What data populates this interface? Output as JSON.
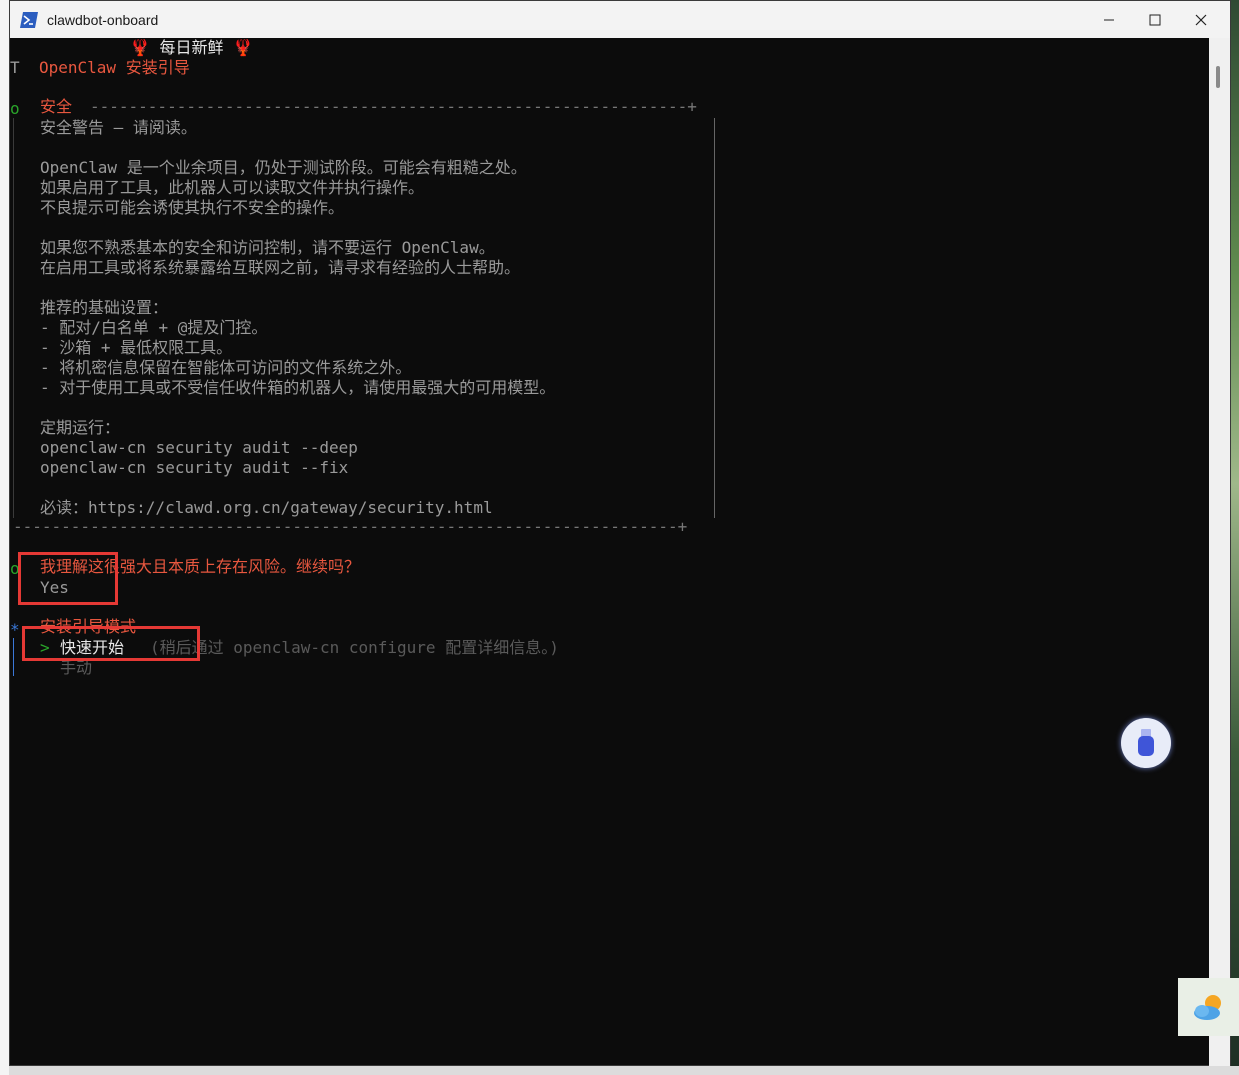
{
  "window": {
    "title": "clawdbot-onboard"
  },
  "terminal": {
    "banner": "🦞 每日新鲜 🦞",
    "heading": "OpenClaw 安装引导",
    "security_title": "安全",
    "warning_lines": [
      "安全警告 — 请阅读。",
      "OpenClaw 是一个业余项目，仍处于测试阶段。可能会有粗糙之处。",
      "如果启用了工具，此机器人可以读取文件并执行操作。",
      "不良提示可能会诱使其执行不安全的操作。",
      "如果您不熟悉基本的安全和访问控制，请不要运行 OpenClaw。",
      "在启用工具或将系统暴露给互联网之前，请寻求有经验的人士帮助。",
      "推荐的基础设置：",
      "- 配对/白名单 + @提及门控。",
      "- 沙箱 + 最低权限工具。",
      "- 将机密信息保留在智能体可访问的文件系统之外。",
      "- 对于使用工具或不受信任收件箱的机器人，请使用最强大的可用模型。",
      "定期运行：",
      "openclaw-cn security audit --deep",
      "openclaw-cn security audit --fix",
      "必读：https://clawd.org.cn/gateway/security.html"
    ],
    "question": "我理解这很强大且本质上存在风险。继续吗？",
    "answer": "Yes",
    "mode_title": "安装引导模式",
    "option_quick": "快速开始",
    "option_quick_hint": "(稍后通过 openclaw-cn configure 配置详细信息。)",
    "option_manual": "手动",
    "markers": {
      "t": "T",
      "o": "o",
      "star": "*",
      "arrow": ">"
    }
  },
  "colors": {
    "accent": "#e8573f",
    "highlight_box": "#e53935"
  }
}
